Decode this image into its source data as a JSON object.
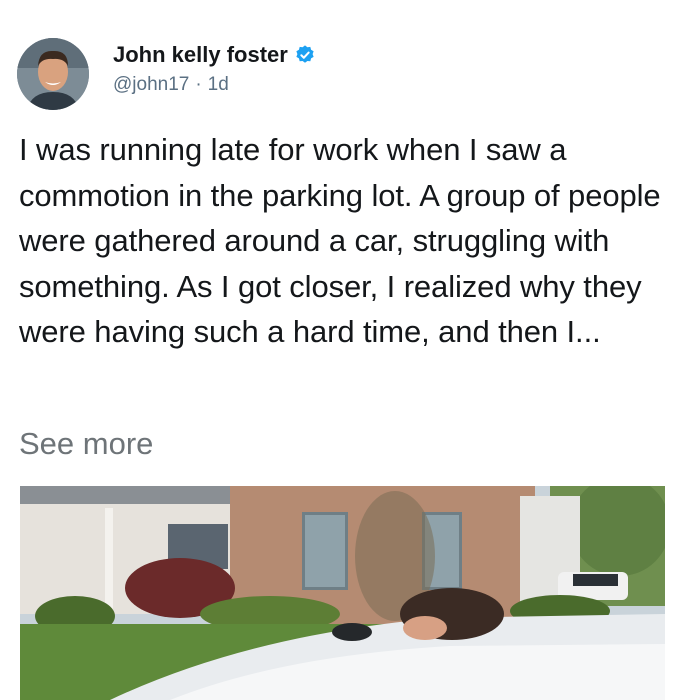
{
  "tweet": {
    "author_name": "John kelly foster",
    "handle": "@john17",
    "separator": "·",
    "time_ago": "1d",
    "text": "I was running late for work when I saw a commotion in the parking lot. A group of people were gathered around a car, struggling with something. As I got closer, I realized why they were having such a hard time, and then I...",
    "see_more": "See more"
  },
  "icons": {
    "verified": "verified-badge-icon"
  },
  "colors": {
    "verified": "#1da1f2",
    "handle": "#5b7083",
    "see_more": "#6e7478"
  }
}
